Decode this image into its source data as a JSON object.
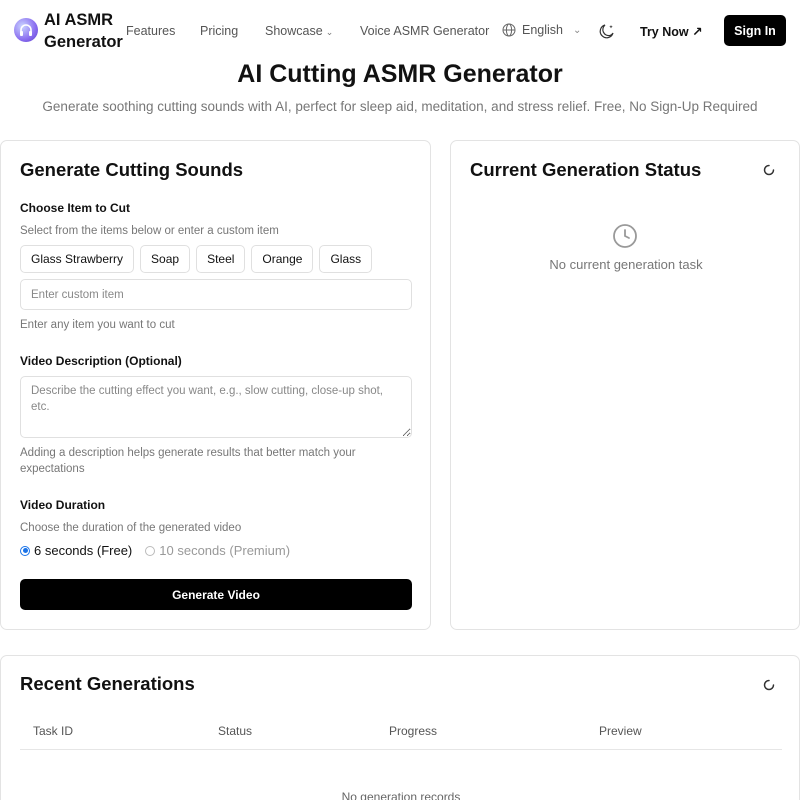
{
  "brand": "AI ASMR Generator",
  "nav": {
    "features": "Features",
    "pricing": "Pricing",
    "showcase": "Showcase",
    "voice": "Voice ASMR Generator",
    "language": "English",
    "try_now": "Try Now ↗",
    "sign_in": "Sign In"
  },
  "hero": {
    "title": "AI Cutting ASMR Generator",
    "subtitle": "Generate soothing cutting sounds with AI, perfect for sleep aid, meditation, and stress relief. Free, No Sign-Up Required"
  },
  "generate": {
    "title": "Generate Cutting Sounds",
    "item_label": "Choose Item to Cut",
    "item_hint": "Select from the items below or enter a custom item",
    "items": [
      "Glass Strawberry",
      "Soap",
      "Steel",
      "Orange",
      "Glass"
    ],
    "custom_placeholder": "Enter custom item",
    "custom_hint": "Enter any item you want to cut",
    "desc_label": "Video Description (Optional)",
    "desc_placeholder": "Describe the cutting effect you want, e.g., slow cutting, close-up shot, etc.",
    "desc_hint": "Adding a description helps generate results that better match your expectations",
    "duration_label": "Video Duration",
    "duration_hint": "Choose the duration of the generated video",
    "duration_options": [
      "6 seconds (Free)",
      "10 seconds (Premium)"
    ],
    "selected_duration": "6 seconds (Free)",
    "button": "Generate Video"
  },
  "status": {
    "title": "Current Generation Status",
    "empty": "No current generation task"
  },
  "recent": {
    "title": "Recent Generations",
    "columns": [
      "Task ID",
      "Status",
      "Progress",
      "Preview"
    ],
    "empty": "No generation records"
  },
  "colors": {
    "primary": "#000000",
    "radio_accent": "#1a73e8",
    "muted_text": "#777777",
    "border": "#e3e3e3"
  }
}
